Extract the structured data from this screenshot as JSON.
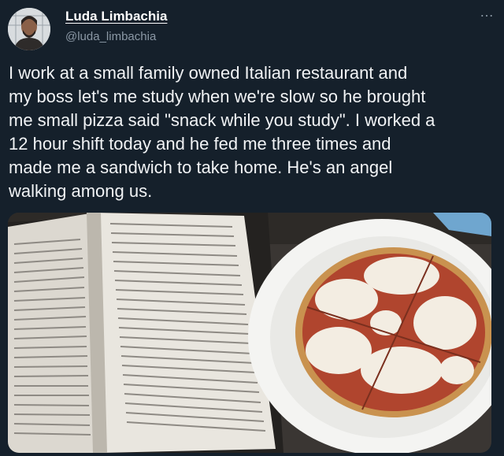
{
  "author": {
    "display_name": "Luda Limbachia",
    "handle": "@luda_limbachia",
    "avatar_icon": "user-avatar"
  },
  "menu": {
    "more_label": "…",
    "icon": "more-options-icon"
  },
  "tweet": {
    "text": "I work at a small family owned Italian restaurant and\nmy boss let's me study when we're slow so he brought\nme small pizza said \"snack while you study\". I worked a\n12 hour shift today and he  fed me three times and\nmade me a sandwich to take home. He's an angel\nwalking among us."
  },
  "colors": {
    "background": "#15202b",
    "text": "#e7e9ea",
    "secondary_text": "#8b98a5"
  }
}
